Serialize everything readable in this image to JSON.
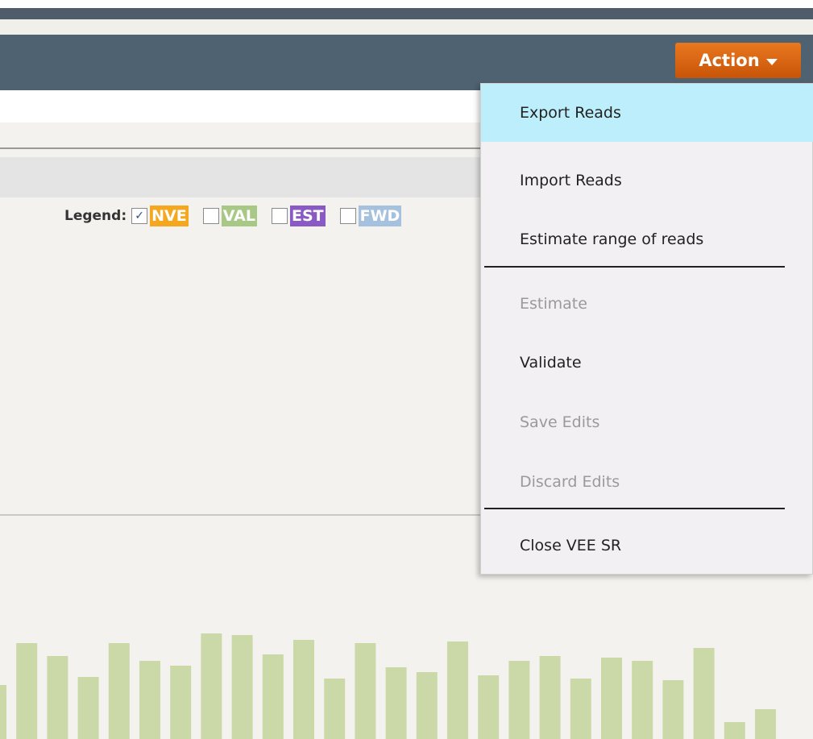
{
  "header": {
    "action_button": {
      "label": "Action",
      "caret_icon": "caret-down-icon"
    }
  },
  "legend": {
    "label": "Legend:",
    "items": [
      {
        "tag": "NVE",
        "checked": true,
        "color": "#f5a81f"
      },
      {
        "tag": "VAL",
        "checked": false,
        "color": "#a8c886"
      },
      {
        "tag": "EST",
        "checked": false,
        "color": "#8a5ac4"
      },
      {
        "tag": "FWD",
        "checked": false,
        "color": "#a6c1dd"
      }
    ]
  },
  "action_menu": {
    "items": [
      {
        "label": "Export Reads",
        "state": "highlighted"
      },
      {
        "label": "Import Reads",
        "state": "enabled"
      },
      {
        "label": "Estimate range of reads",
        "state": "enabled"
      },
      {
        "label": "Estimate",
        "state": "disabled"
      },
      {
        "label": "Validate",
        "state": "enabled"
      },
      {
        "label": "Save Edits",
        "state": "disabled"
      },
      {
        "label": "Discard Edits",
        "state": "disabled"
      },
      {
        "label": "Close VEE SR",
        "state": "enabled"
      }
    ]
  },
  "chart_data": {
    "type": "bar",
    "series": [
      {
        "values": [
          67,
          119,
          103,
          77,
          119,
          97,
          91,
          131,
          129,
          105,
          123,
          75,
          119,
          89,
          83,
          121,
          79,
          97,
          103,
          75,
          101,
          97,
          73,
          113,
          21,
          37
        ],
        "color": "#cbd9a9"
      }
    ]
  }
}
